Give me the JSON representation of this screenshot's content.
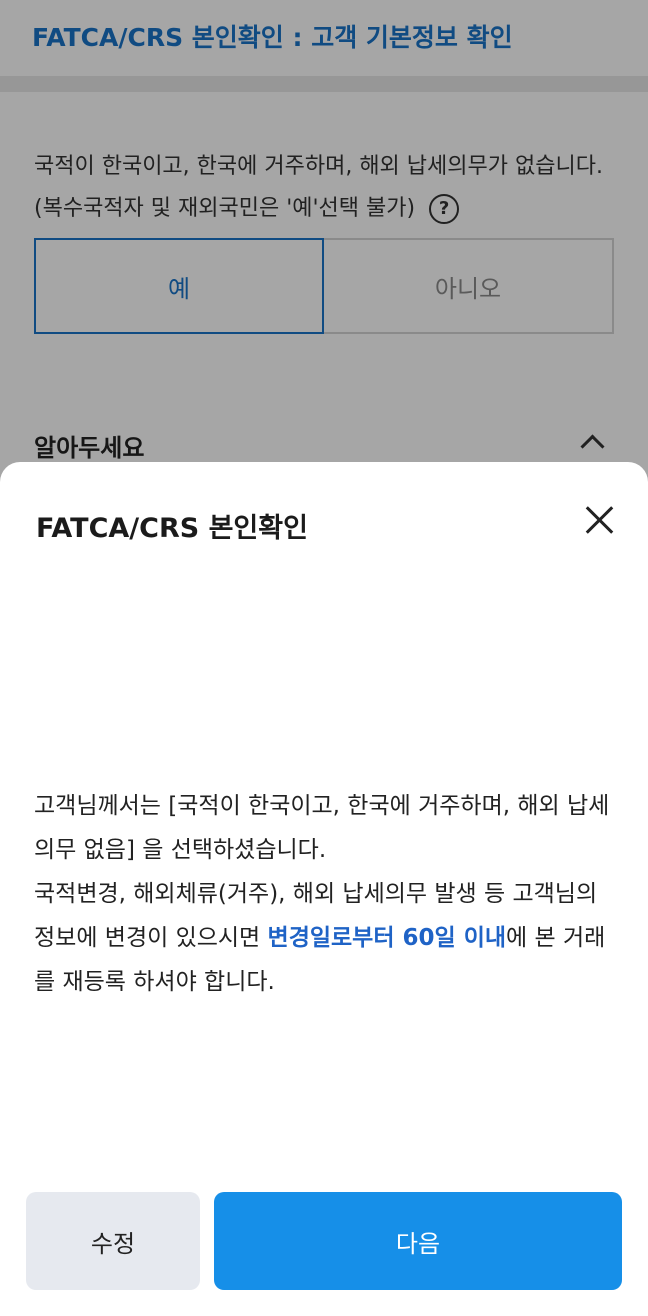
{
  "header": {
    "title": "FATCA/CRS 본인확인 : 고객 기본정보 확인"
  },
  "question": {
    "text": "국적이 한국이고, 한국에 거주하며, 해외 납세의무가 없습니다. (복수국적자 및 재외국민은 '예'선택 불가)",
    "help_icon": "?"
  },
  "choices": {
    "yes": "예",
    "no": "아니오",
    "selected": "예"
  },
  "notice": {
    "title": "알아두세요"
  },
  "sheet": {
    "title": "FATCA/CRS 본인확인",
    "body_part1": "고객님께서는 [국적이 한국이고, 한국에 거주하며, 해외 납세의무 없음] 을 선택하셨습니다.",
    "body_part2": "국적변경, 해외체류(거주), 해외 납세의무 발생 등 고객님의 정보에 변경이 있으시면 ",
    "body_highlight": "변경일로부터 60일 이내",
    "body_part3": "에 본 거래를 재등록 하셔야 합니다."
  },
  "buttons": {
    "edit": "수정",
    "next": "다음"
  },
  "colors": {
    "accent": "#1a73c8",
    "primary_button": "#168fe8",
    "secondary_button": "#e6e9ef"
  }
}
